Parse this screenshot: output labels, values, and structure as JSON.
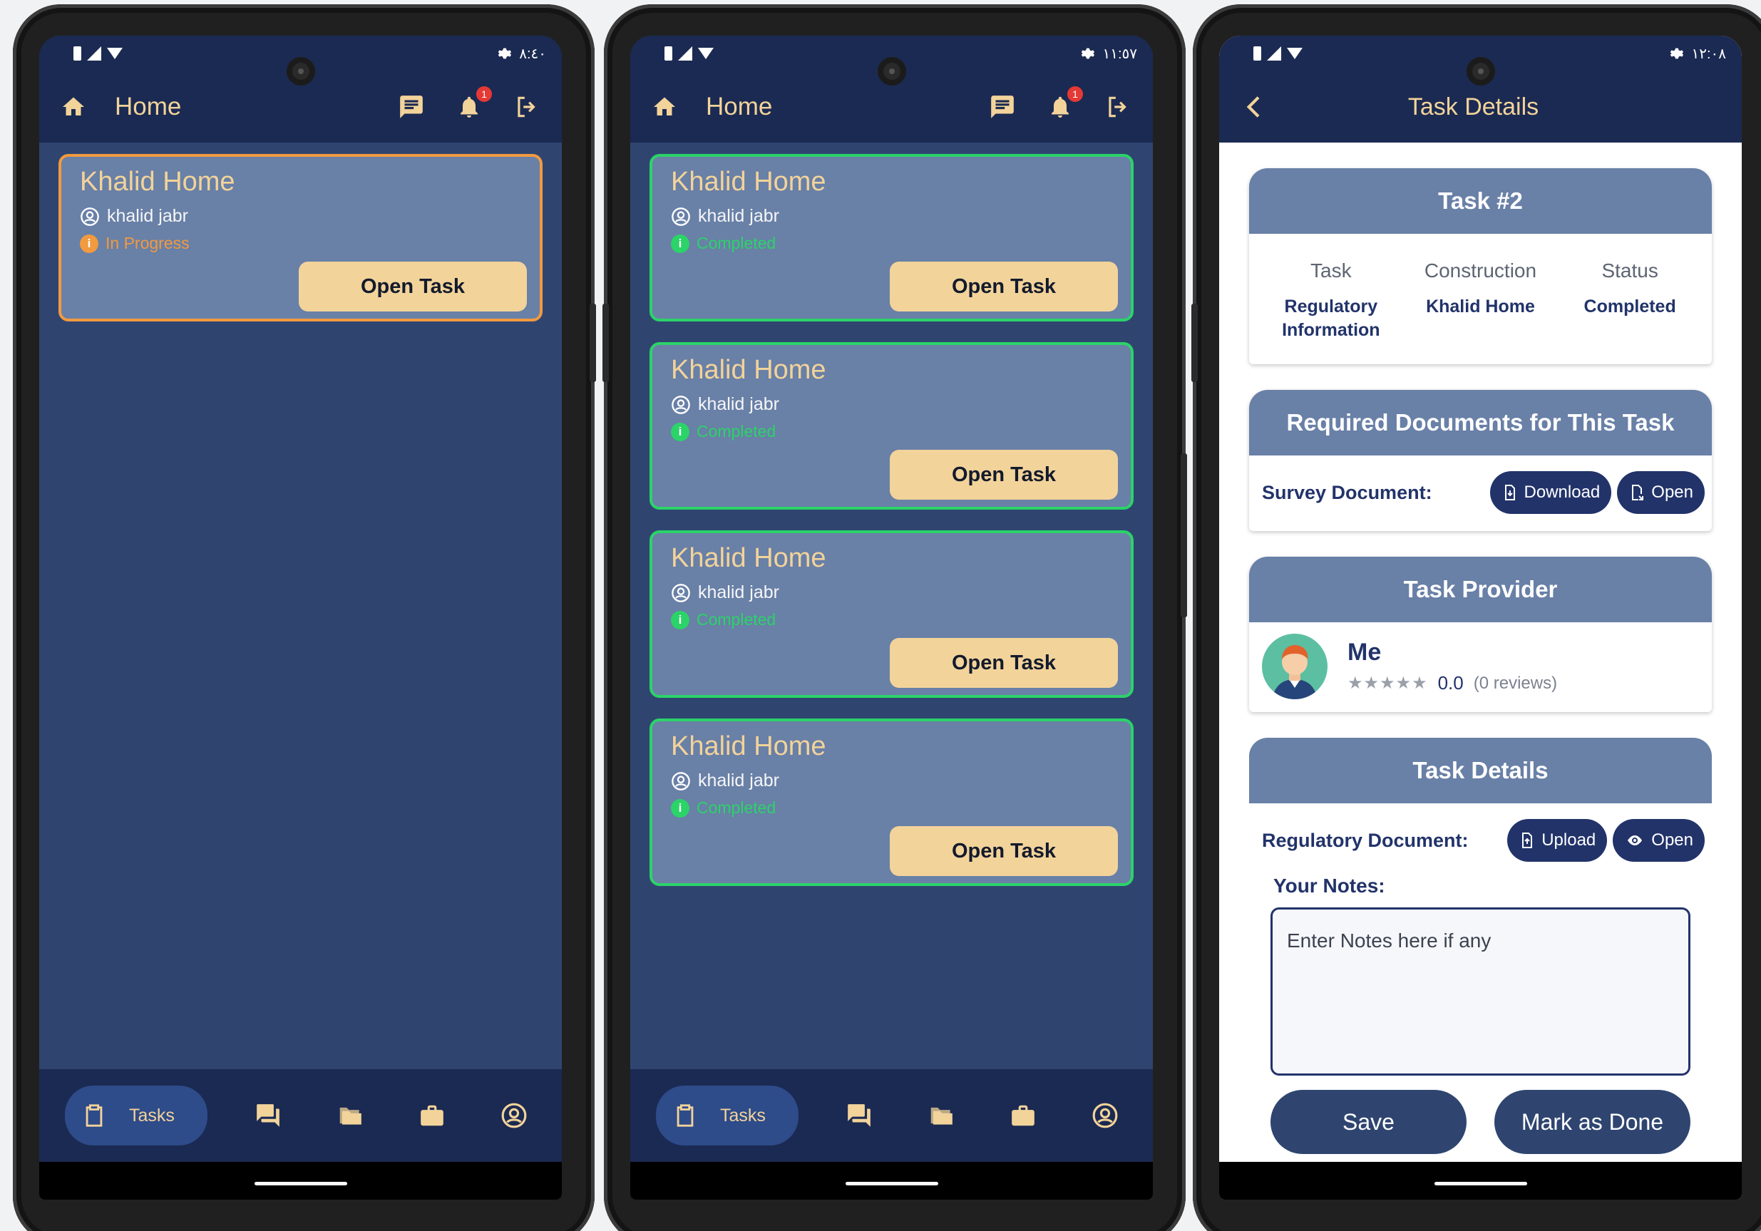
{
  "colors": {
    "appbar": "#1b2a52",
    "background": "#2f4570",
    "card": "#6980a7",
    "accent": "#f2d39a",
    "completed": "#2bd368",
    "in_progress": "#f29a3f",
    "navy_text": "#22336a"
  },
  "screen1": {
    "status_time": "٨:٤٠",
    "appbar": {
      "title": "Home"
    },
    "notification_count": "1",
    "cards": [
      {
        "title": "Khalid Home",
        "user": "khalid jabr",
        "status": "In Progress",
        "button": "Open Task"
      }
    ],
    "nav": {
      "tasks_label": "Tasks"
    }
  },
  "screen2": {
    "status_time": "١١:٥٧",
    "appbar": {
      "title": "Home"
    },
    "notification_count": "1",
    "cards": [
      {
        "title": "Khalid Home",
        "user": "khalid jabr",
        "status": "Completed",
        "button": "Open Task"
      },
      {
        "title": "Khalid Home",
        "user": "khalid jabr",
        "status": "Completed",
        "button": "Open Task"
      },
      {
        "title": "Khalid Home",
        "user": "khalid jabr",
        "status": "Completed",
        "button": "Open Task"
      },
      {
        "title": "Khalid Home",
        "user": "khalid jabr",
        "status": "Completed",
        "button": "Open Task"
      }
    ],
    "nav": {
      "tasks_label": "Tasks"
    }
  },
  "screen3": {
    "status_time": "١٢:٠٨",
    "appbar": {
      "title": "Task Details"
    },
    "task_card": {
      "title": "Task #2",
      "columns": [
        {
          "label": "Task",
          "value": "Regulatory Information"
        },
        {
          "label": "Construction",
          "value": "Khalid Home"
        },
        {
          "label": "Status",
          "value": "Completed"
        }
      ]
    },
    "required_docs": {
      "title": "Required Documents for This Task",
      "label": "Survey Document:",
      "download": "Download",
      "open": "Open"
    },
    "provider": {
      "title": "Task Provider",
      "name": "Me",
      "stars": "★★★★★",
      "rating": "0.0",
      "reviews": "(0  reviews)"
    },
    "details": {
      "title": "Task Details",
      "label": "Regulatory Document:",
      "upload": "Upload",
      "open": "Open",
      "notes_label": "Your Notes:",
      "notes_placeholder": "Enter Notes here if any",
      "save": "Save",
      "done": "Mark as Done"
    }
  }
}
